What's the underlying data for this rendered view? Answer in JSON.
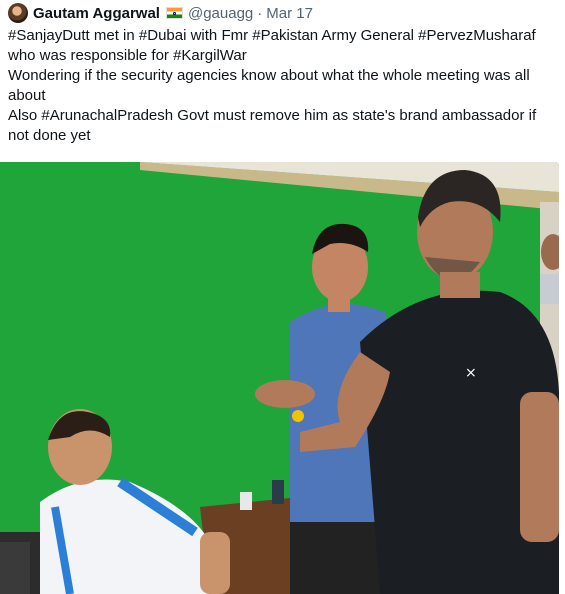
{
  "tweet": {
    "author_name": "Gautam Aggarwal",
    "flag_icon": "india-flag-icon",
    "handle": "@gauagg",
    "separator": "·",
    "date": "Mar 17",
    "text_lines": [
      "#SanjayDutt met in #Dubai with Fmr #Pakistan Army General #PervezMusharaf",
      "who was responsible for #KargilWar",
      "Wondering if the security agencies know about what the whole meeting was all",
      "about",
      "Also #ArunachalPradesh Govt must remove him as state's brand ambassador if",
      "not done yet"
    ]
  },
  "colors": {
    "wall_green": "#1fa53a",
    "text_primary": "#0f1419",
    "text_secondary": "#536471"
  }
}
